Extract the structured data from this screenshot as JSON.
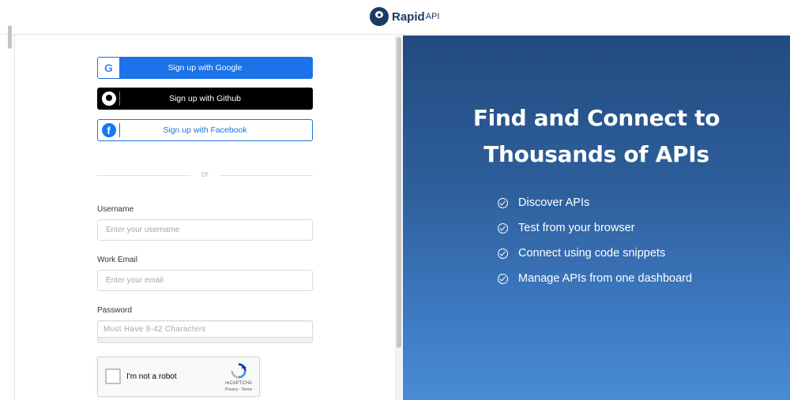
{
  "header": {
    "logo_text": "Rapid",
    "logo_sub": "API"
  },
  "sso": {
    "google_label": "Sign up with Google",
    "github_label": "Sign up with Github",
    "facebook_label": "Sign up with Facebook"
  },
  "divider_text": "or",
  "form": {
    "username_label": "Username",
    "username_placeholder": "Enter your username",
    "email_label": "Work Email",
    "email_placeholder": "Enter your email",
    "password_label": "Password",
    "password_placeholder": "Must Have 8-42 Characters"
  },
  "captcha": {
    "label": "I'm not a robot",
    "brand": "reCAPTCHA",
    "links": "Privacy - Terms"
  },
  "hero": {
    "line1": "Find and Connect to",
    "line2": "Thousands of APIs"
  },
  "features": [
    "Discover APIs",
    "Test from your browser",
    "Connect using code snippets",
    "Manage APIs from one dashboard"
  ],
  "colors": {
    "brand": "#1b3a63",
    "google_blue": "#1a73e8",
    "panel_top": "#224a80",
    "panel_bottom": "#4a8bd6"
  },
  "icons": [
    "rapidapi-logo-icon",
    "google-icon",
    "github-icon",
    "facebook-icon",
    "check-circle-icon",
    "recaptcha-icon"
  ]
}
